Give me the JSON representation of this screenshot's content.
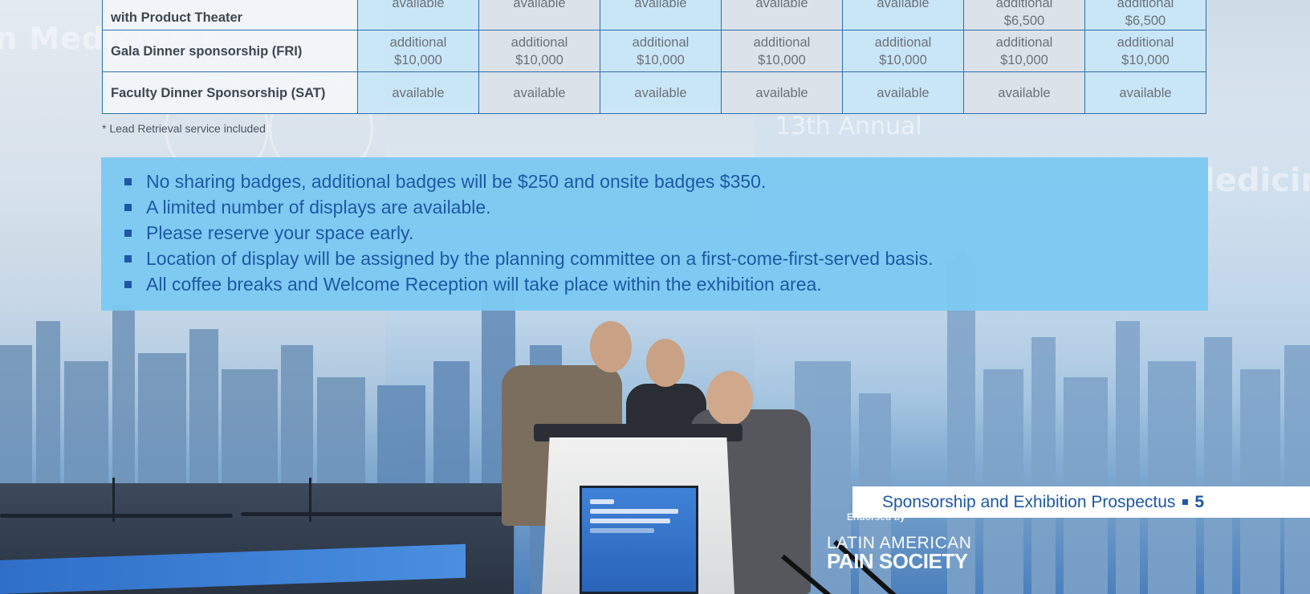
{
  "table": {
    "rows": [
      {
        "label_line1": "",
        "label_line2": "with Product Theater",
        "cells": [
          {
            "l1": "available",
            "l2": ""
          },
          {
            "l1": "available",
            "l2": ""
          },
          {
            "l1": "available",
            "l2": ""
          },
          {
            "l1": "available",
            "l2": ""
          },
          {
            "l1": "available",
            "l2": ""
          },
          {
            "l1": "additional",
            "l2": "$6,500"
          },
          {
            "l1": "additional",
            "l2": "$6,500"
          }
        ]
      },
      {
        "label_line1": "Gala Dinner sponsorship (FRI)",
        "label_line2": "",
        "cells": [
          {
            "l1": "additional",
            "l2": "$10,000"
          },
          {
            "l1": "additional",
            "l2": "$10,000"
          },
          {
            "l1": "additional",
            "l2": "$10,000"
          },
          {
            "l1": "additional",
            "l2": "$10,000"
          },
          {
            "l1": "additional",
            "l2": "$10,000"
          },
          {
            "l1": "additional",
            "l2": "$10,000"
          },
          {
            "l1": "additional",
            "l2": "$10,000"
          }
        ]
      },
      {
        "label_line1": "Faculty Dinner Sponsorship (SAT)",
        "label_line2": "",
        "cells": [
          {
            "l1": "available",
            "l2": ""
          },
          {
            "l1": "available",
            "l2": ""
          },
          {
            "l1": "available",
            "l2": ""
          },
          {
            "l1": "available",
            "l2": ""
          },
          {
            "l1": "available",
            "l2": ""
          },
          {
            "l1": "available",
            "l2": ""
          },
          {
            "l1": "available",
            "l2": ""
          }
        ]
      }
    ]
  },
  "footnote": "* Lead Retrieval service included",
  "notes": [
    "No sharing badges, additional badges will be $250 and onsite badges $350.",
    "A limited number of displays are available.",
    "Please reserve your space early.",
    "Location of display will be assigned by the planning committee on a first-come-first-served basis.",
    "All coffee breaks and Welcome Reception will take place within the exhibition area."
  ],
  "background": {
    "faded_left": "n Medicine C",
    "faded_right": "ledicine",
    "faded_annual": "13th Annual",
    "endorsed_by": "Endorsed by",
    "society_line1": "LATIN AMERICAN",
    "society_line2": "PAIN SOCIETY"
  },
  "footer": {
    "title": "Sponsorship and Exhibition Prospectus",
    "page_number": "5"
  },
  "colors": {
    "accent_blue": "#1d58a6",
    "notes_bg": "#7cc9f1",
    "table_border": "#2f6fa8"
  }
}
